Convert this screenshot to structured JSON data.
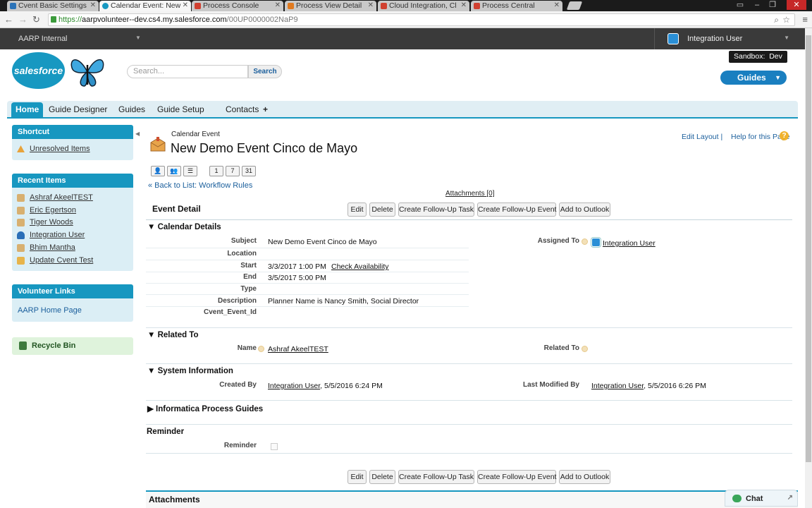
{
  "browser": {
    "tabs": [
      {
        "label": "Cvent Basic Settings"
      },
      {
        "label": "Calendar Event: New"
      },
      {
        "label": "Process Console"
      },
      {
        "label": "Process View Detail"
      },
      {
        "label": "Cloud Integration, Cl"
      },
      {
        "label": "Process Central"
      }
    ],
    "url_scheme": "https://",
    "url_host": "aarpvolunteer--dev.cs4.my.salesforce.com",
    "url_path": "/00UP0000002NaP9"
  },
  "header": {
    "org_name": "AARP Internal",
    "user_name": "Integration User",
    "sandbox_label": "Sandbox:",
    "sandbox_name": "Dev",
    "logo_text": "salesforce",
    "search_placeholder": "Search...",
    "search_button": "Search",
    "guides_button": "Guides"
  },
  "nav_tabs": [
    "Home",
    "Guide Designer",
    "Guides",
    "Guide Setup",
    "Contacts",
    "+"
  ],
  "sidebar": {
    "shortcut_title": "Shortcut",
    "shortcut_items": [
      "Unresolved Items"
    ],
    "recent_title": "Recent Items",
    "recent_items": [
      "Ashraf AkeelTEST",
      "Eric Egertson",
      "Tiger Woods",
      "Integration User",
      "Bhim Mantha",
      "Update Cvent Test"
    ],
    "volunteer_title": "Volunteer Links",
    "volunteer_items": [
      "AARP Home Page"
    ],
    "recycle_bin": "Recycle Bin"
  },
  "record": {
    "object_type": "Calendar Event",
    "title": "New Demo Event Cinco de Mayo",
    "edit_layout": "Edit Layout",
    "separator": "|",
    "help": "Help for this Page",
    "view_buttons": [
      "",
      "",
      "",
      "1",
      "7",
      "31"
    ],
    "back_to_list": "« Back to List: Workflow Rules",
    "attachments_link": "Attachments",
    "attachments_count": "[0]",
    "detail_title": "Event Detail",
    "buttons": [
      "Edit",
      "Delete",
      "Create Follow-Up Task",
      "Create Follow-Up Event",
      "Add to Outlook"
    ]
  },
  "sections": {
    "calendar_details": "Calendar Details",
    "related_to": "Related To",
    "system_information": "System Information",
    "informatica": "Informatica Process Guides",
    "reminder": "Reminder"
  },
  "fields": {
    "subject_label": "Subject",
    "subject_value": "New Demo Event Cinco de Mayo",
    "location_label": "Location",
    "start_label": "Start",
    "start_value": "3/3/2017 1:00 PM",
    "check_availability": "Check Availability",
    "end_label": "End",
    "end_value": "3/5/2017 5:00 PM",
    "type_label": "Type",
    "description_label": "Description",
    "description_value": "Planner Name is Nancy Smith, Social Director",
    "cvent_label": "Cvent_Event_Id",
    "assigned_label": "Assigned To",
    "assigned_value": "Integration User",
    "name_label": "Name",
    "name_value": "Ashraf AkeelTEST",
    "related_label": "Related To",
    "created_label": "Created By",
    "created_user": "Integration User",
    "created_date": ", 5/5/2016 6:24 PM",
    "modified_label": "Last Modified By",
    "modified_user": "Integration User",
    "modified_date": ", 5/5/2016 6:26 PM",
    "reminder_label": "Reminder"
  },
  "attachments_section": "Attachments",
  "chat": "Chat",
  "icons": [
    "back-icon",
    "forward-icon",
    "reload-icon",
    "lock-icon",
    "zoom-icon",
    "star-icon",
    "menu-icon",
    "warning-icon",
    "user-icon",
    "help-icon",
    "chat-icon",
    "recycle-icon"
  ]
}
